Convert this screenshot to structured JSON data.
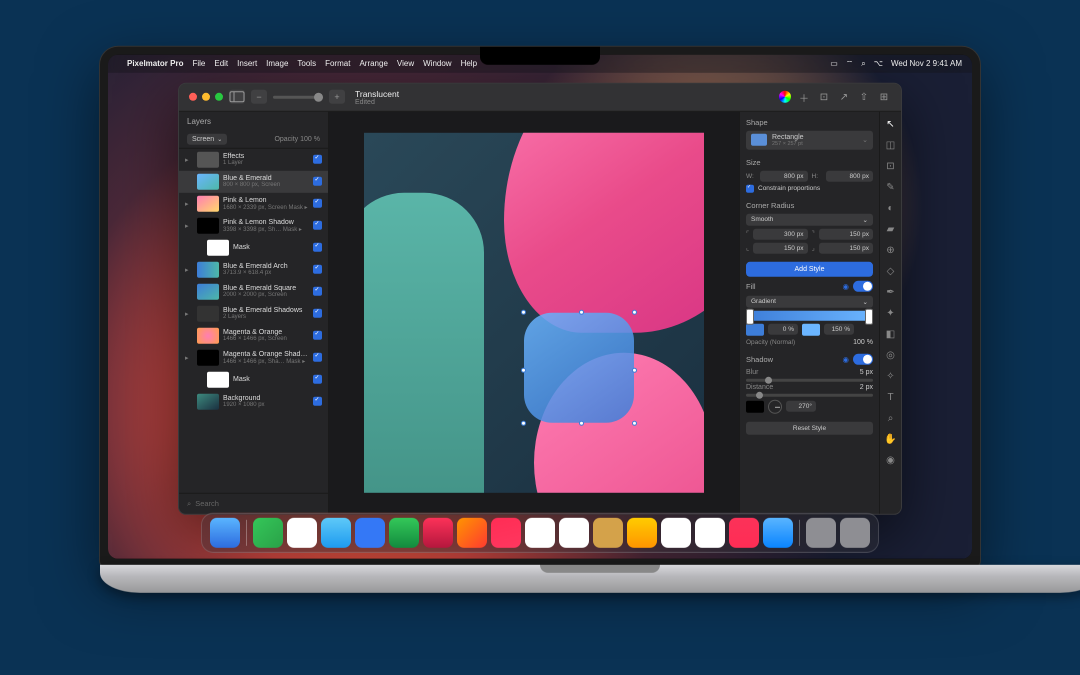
{
  "menubar": {
    "app": "Pixelmator Pro",
    "items": [
      "File",
      "Edit",
      "Insert",
      "Image",
      "Tools",
      "Format",
      "Arrange",
      "View",
      "Window",
      "Help"
    ],
    "datetime": "Wed Nov 2  9:41 AM"
  },
  "window": {
    "title": "Translucent",
    "subtitle": "Edited"
  },
  "layers_panel": {
    "title": "Layers",
    "blend_mode": "Screen",
    "opacity_label": "Opacity",
    "opacity_value": "100 %",
    "search_placeholder": "Search",
    "items": [
      {
        "name": "Effects",
        "meta": "1 Layer",
        "thumb": "#555",
        "arrow": true
      },
      {
        "name": "Blue & Emerald",
        "meta": "800 × 800 px, Screen",
        "thumb": "linear-gradient(145deg,#6bb5ff,#4db8a8)",
        "selected": true
      },
      {
        "name": "Pink & Lemon",
        "meta": "1680 × 2339 px, Screen   Mask ▸",
        "thumb": "linear-gradient(145deg,#ff7eb3,#ffd86b)",
        "arrow": true
      },
      {
        "name": "Pink & Lemon Shadow",
        "meta": "3398 × 3398 px, Sh…   Mask ▸",
        "thumb": "#000",
        "arrow": true
      },
      {
        "name": "Mask",
        "meta": "",
        "thumb": "#fff",
        "indent": true
      },
      {
        "name": "Blue & Emerald Arch",
        "meta": "3713.9 × 618.4 px",
        "thumb": "linear-gradient(90deg,#3d7dd8,#4db8a8)",
        "arrow": true
      },
      {
        "name": "Blue & Emerald Square",
        "meta": "2000 × 2000 px, Screen",
        "thumb": "linear-gradient(145deg,#3d7dd8,#4db8a8)"
      },
      {
        "name": "Blue & Emerald Shadows",
        "meta": "2 Layers",
        "thumb": "#333",
        "arrow": true
      },
      {
        "name": "Magenta & Orange",
        "meta": "1466 × 1466 px, Screen",
        "thumb": "radial-gradient(circle,#ff7eb3,#ff9d4d)"
      },
      {
        "name": "Magenta & Orange Shadow",
        "meta": "1466 × 1466 px, Sha…   Mask ▸",
        "thumb": "#000",
        "arrow": true
      },
      {
        "name": "Mask",
        "meta": "",
        "thumb": "#fff",
        "indent": true
      },
      {
        "name": "Background",
        "meta": "1920 × 1080 px",
        "thumb": "linear-gradient(145deg,#3d8a7e,#1a3040)"
      }
    ]
  },
  "props": {
    "shape_title": "Shape",
    "shape_name": "Rectangle",
    "shape_meta": "257 × 257 pt",
    "size_title": "Size",
    "w_label": "W:",
    "w_value": "800 px",
    "h_label": "H:",
    "h_value": "800 px",
    "constrain": "Constrain proportions",
    "corner_title": "Corner Radius",
    "corner_mode": "Smooth",
    "corners": {
      "tl": "300 px",
      "tr": "150 px",
      "bl": "150 px",
      "br": "150 px"
    },
    "add_style": "Add Style",
    "fill_title": "Fill",
    "fill_type": "Gradient",
    "fill_val1": "0 %",
    "fill_val2": "150 %",
    "fill_opacity_label": "Opacity (Normal)",
    "fill_opacity": "100 %",
    "shadow_title": "Shadow",
    "blur_label": "Blur",
    "blur_value": "5 px",
    "distance_label": "Distance",
    "distance_value": "2 px",
    "angle_value": "270°",
    "reset": "Reset Style"
  },
  "dock_colors": [
    "linear-gradient(180deg,#5ab5ff,#2d6cdf)",
    "linear-gradient(135deg,#34c759,#2aa148)",
    "#fff",
    "linear-gradient(180deg,#5fc9f8,#1d9bf0)",
    "#3478f6",
    "linear-gradient(180deg,#34c759,#128c3e)",
    "linear-gradient(180deg,#fc3259,#b5173d)",
    "linear-gradient(135deg,#ff9500,#ff3b30)",
    "linear-gradient(165deg,#ff2d55,#ff375f)",
    "#fff",
    "#fff",
    "#d4a24a",
    "linear-gradient(180deg,#ffcc00,#ff9500)",
    "#fff",
    "#fff",
    "linear-gradient(180deg,#fc3259,#ff2d55)",
    "linear-gradient(180deg,#5ab5ff,#0a84ff)",
    "#8e8e93",
    "#8e8e93"
  ]
}
